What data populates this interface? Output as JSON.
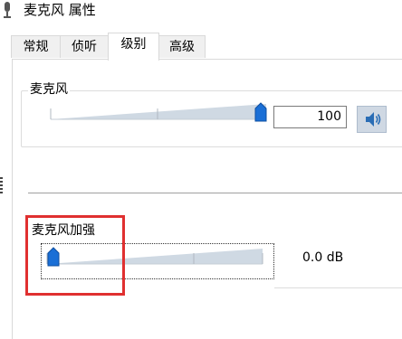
{
  "window": {
    "title": "麦克风 属性"
  },
  "tabs": [
    {
      "label": "常规",
      "active": false
    },
    {
      "label": "侦听",
      "active": false
    },
    {
      "label": "级别",
      "active": true
    },
    {
      "label": "高级",
      "active": false
    }
  ],
  "microphone": {
    "label": "麦克风",
    "level": 100,
    "value_text": "100",
    "mute_icon": "speaker-icon"
  },
  "boost": {
    "label": "麦克风加强",
    "level_db": 0.0,
    "value_text": "0.0 dB"
  },
  "colors": {
    "slider_thumb": "#1a6fd6",
    "highlight": "#e03030"
  }
}
